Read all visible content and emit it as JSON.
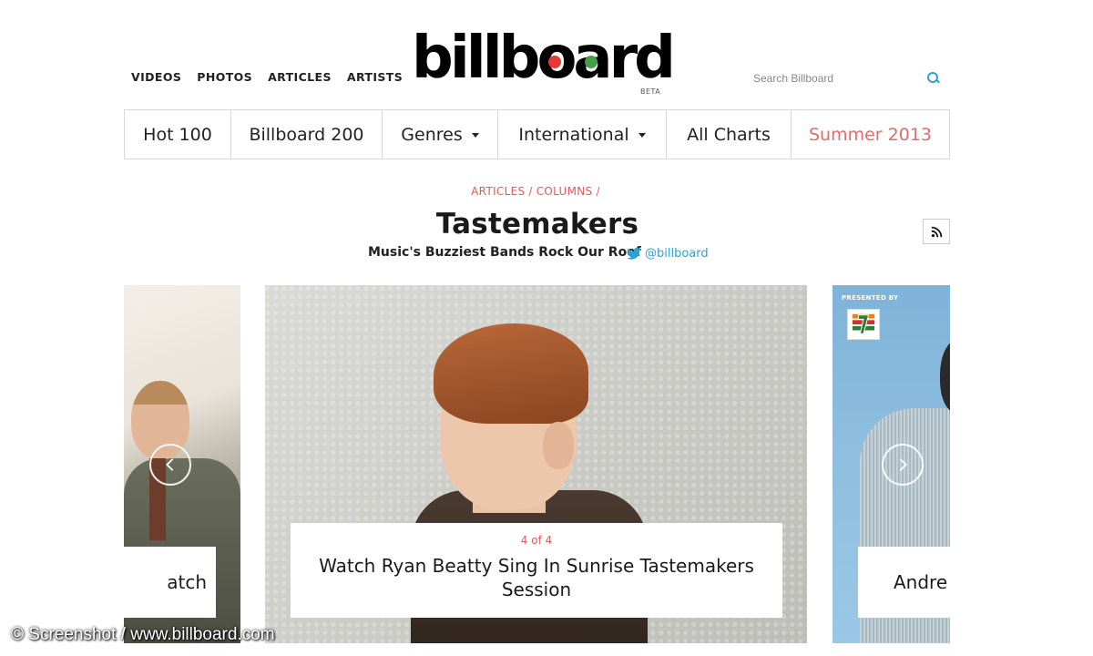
{
  "topnav": {
    "items": [
      "VIDEOS",
      "PHOTOS",
      "ARTICLES",
      "ARTISTS"
    ]
  },
  "logo": {
    "text": "billboard",
    "beta": "BETA",
    "dot_colors": [
      "#e53935",
      "#43a047",
      "#fdd835",
      "#1e88e5",
      "#fb8c00"
    ]
  },
  "search": {
    "placeholder": "Search Billboard"
  },
  "chartbar": {
    "items": [
      {
        "label": "Hot 100"
      },
      {
        "label": "Billboard 200"
      },
      {
        "label": "Genres"
      },
      {
        "label": "International"
      },
      {
        "label": "All Charts"
      },
      {
        "label": "Summer 2013"
      }
    ]
  },
  "breadcrumb": {
    "items": [
      "ARTICLES",
      "COLUMNS"
    ],
    "separator": "/"
  },
  "page": {
    "title": "Tastemakers",
    "subtitle": "Music's Buzziest Bands Rock Our Roof",
    "twitter_handle": "@billboard"
  },
  "carousel": {
    "main": {
      "count": "4 of 4",
      "caption": "Watch Ryan Beatty Sing In Sunrise Tastemakers Session"
    },
    "left": {
      "caption": "atch"
    },
    "right": {
      "caption": "Andre",
      "presented_by": "PRESENTED BY"
    }
  },
  "watermark": "© Screenshot / www.billboard.com",
  "colors": {
    "accent": "#e25a5a",
    "twitter": "#2aa3d8"
  }
}
